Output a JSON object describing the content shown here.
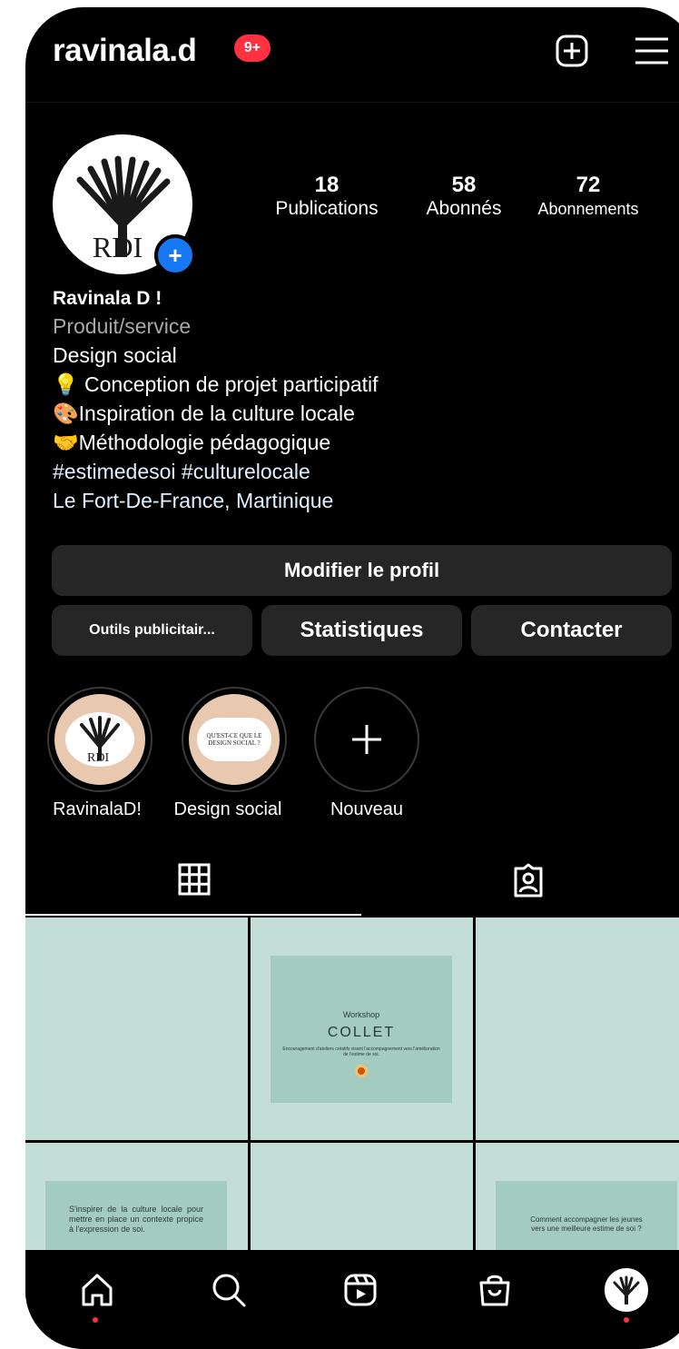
{
  "header": {
    "username": "ravinala.d",
    "notification_badge": "9+",
    "new_post_icon": "plus-square-icon",
    "menu_icon": "hamburger-menu-icon"
  },
  "profile": {
    "stats": [
      {
        "value": "18",
        "label": "Publications"
      },
      {
        "value": "58",
        "label": "Abonnés"
      },
      {
        "value": "72",
        "label": "Abonnements"
      }
    ],
    "avatar_text": "RDI",
    "name": "Ravinala D !",
    "category": "Produit/service",
    "bio_lines": [
      "Design social",
      "💡 Conception de projet participatif",
      "🎨Inspiration de la culture locale",
      "🤝Méthodologie pédagogique"
    ],
    "hashtags": "#estimedesoi #culturelocale",
    "location": "Le Fort-De-France, Martinique"
  },
  "buttons": {
    "edit_profile": "Modifier le profil",
    "ad_tools": "Outils publicitair...",
    "stats": "Statistiques",
    "contact": "Contacter"
  },
  "highlights": [
    {
      "label": "RavinalaD!",
      "cover_text": "RDI"
    },
    {
      "label": "Design social",
      "cover_text": "QU'EST-CE QUE LE DESIGN SOCIAL ?"
    },
    {
      "label": "Nouveau"
    }
  ],
  "tabs": {
    "grid_icon": "grid-icon",
    "tagged_icon": "tagged-person-icon"
  },
  "posts": [
    {
      "title_small": "Workshop",
      "title": "COLLET",
      "caption": "Encouragement d'ateliers créatifs visant l'accompagnement vers l'amélioration de l'estime de soi."
    },
    {
      "caption": "S'inspirer de la culture locale pour mettre en place un contexte propice à l'expression de soi."
    },
    {
      "caption": "Comment accompagner les jeunes vers une meilleure estime de soi ?"
    }
  ],
  "nav": {
    "home": "home-icon",
    "search": "search-icon",
    "reels": "reels-icon",
    "shop": "shop-icon",
    "profile": "profile-avatar"
  },
  "colors": {
    "background": "#000000",
    "button": "#262626",
    "accent_blue": "#1877f2",
    "badge_red": "#ff3040",
    "post_bg": "#c3ded7",
    "hashtag": "#e0f1ff"
  }
}
